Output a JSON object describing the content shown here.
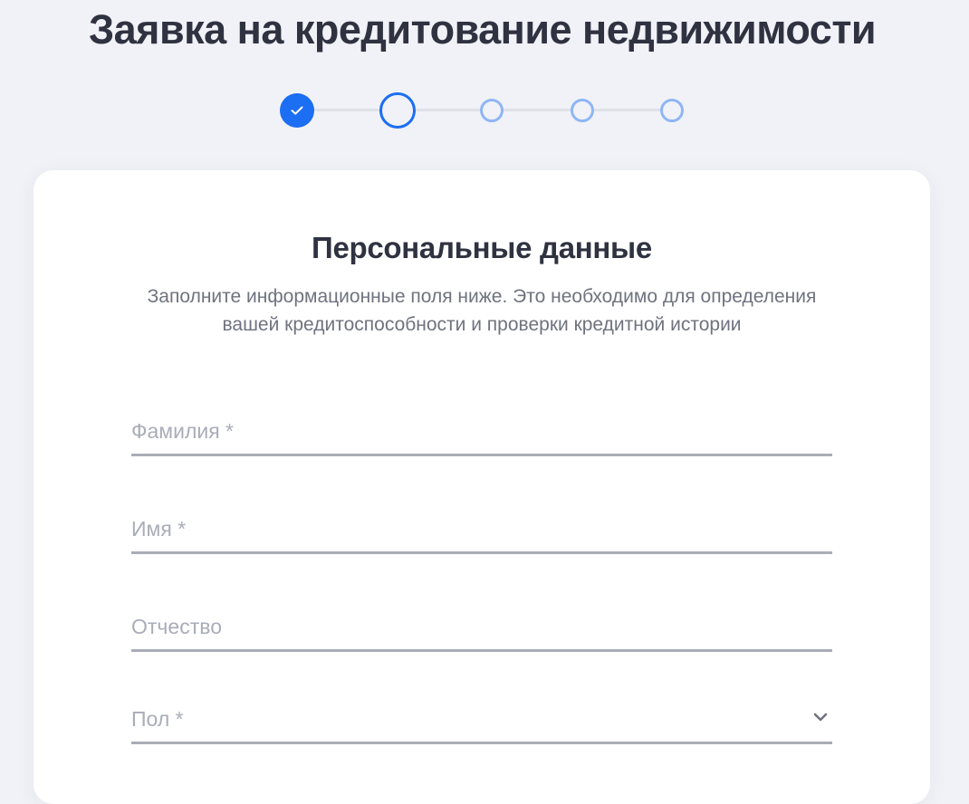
{
  "page": {
    "title": "Заявка на кредитование недвижимости"
  },
  "stepper": {
    "steps": [
      {
        "state": "completed",
        "icon": "check-icon"
      },
      {
        "state": "current"
      },
      {
        "state": "pending"
      },
      {
        "state": "pending"
      },
      {
        "state": "pending"
      }
    ],
    "colors": {
      "active": "#1c6ef2",
      "pending": "#8fb6f5",
      "connector": "#dfe1e8"
    }
  },
  "form": {
    "section_title": "Персональные данные",
    "section_description": "Заполните информационные поля ниже. Это необходимо для определения вашей кредитоспособности и проверки кредитной истории",
    "fields": {
      "last_name": {
        "placeholder": "Фамилия *",
        "value": ""
      },
      "first_name": {
        "placeholder": "Имя *",
        "value": ""
      },
      "middle_name": {
        "placeholder": "Отчество",
        "value": ""
      },
      "gender": {
        "placeholder": "Пол *",
        "value": "",
        "icon": "chevron-down-icon"
      }
    }
  }
}
